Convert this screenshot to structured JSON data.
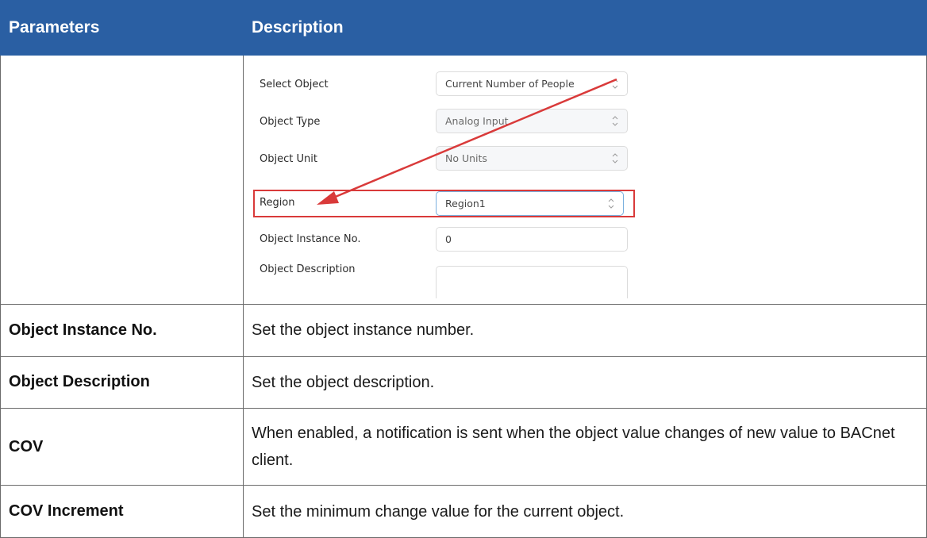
{
  "table": {
    "headers": {
      "parameters": "Parameters",
      "description": "Description"
    },
    "screenshot": {
      "fields": [
        {
          "label": "Select Object",
          "value": "Current Number of People",
          "control": "select"
        },
        {
          "label": "Object Type",
          "value": "Analog Input",
          "control": "select-disabled"
        },
        {
          "label": "Object Unit",
          "value": "No Units",
          "control": "select-disabled"
        },
        {
          "label": "Region",
          "value": "Region1",
          "control": "select-highlighted"
        },
        {
          "label": "Object Instance No.",
          "value": "0",
          "control": "input"
        },
        {
          "label": "Object Description",
          "value": "",
          "control": "input"
        }
      ],
      "annotation": {
        "highlight_color": "#d93a3a",
        "arrow_color": "#d93a3a"
      }
    },
    "rows": [
      {
        "parameter": "Object Instance No.",
        "description": "Set the object instance number."
      },
      {
        "parameter": "Object Description",
        "description": "Set the object description."
      },
      {
        "parameter": "COV",
        "description": "When enabled, a notification is sent when the object value changes of new value to BACnet client."
      },
      {
        "parameter": "COV Increment",
        "description": "Set the minimum change value for the current object."
      }
    ]
  },
  "colors": {
    "header_bg": "#2a5fa3",
    "header_text": "#ffffff",
    "border": "#6b6b6b"
  }
}
